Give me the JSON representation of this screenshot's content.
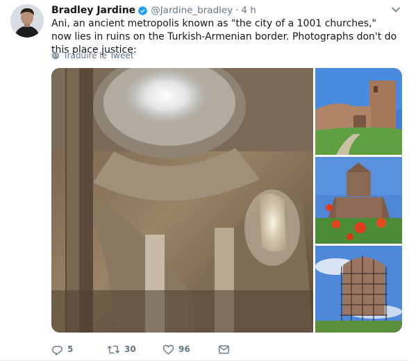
{
  "tweet": {
    "author_name": "Bradley Jardine",
    "handle": "@Jardine_bradley",
    "separator": "·",
    "time": "4 h",
    "text": "Ani, an ancient metropolis known as \"the city of a 1001 churches,\" now lies in ruins on the Turkish-Armenian border. Photographs don't do this place justice:",
    "translate_label": "Traduire le Tweet"
  },
  "actions": {
    "reply_count": "5",
    "retweet_count": "30",
    "like_count": "96"
  },
  "colors": {
    "verified": "#1da1f2",
    "muted": "#657786",
    "text": "#14171a"
  },
  "icons": {
    "verified": "verified-badge-icon",
    "caret": "chevron-down-icon",
    "translate": "globe-icon",
    "reply": "reply-icon",
    "retweet": "retweet-icon",
    "like": "heart-icon",
    "message": "envelope-icon"
  }
}
